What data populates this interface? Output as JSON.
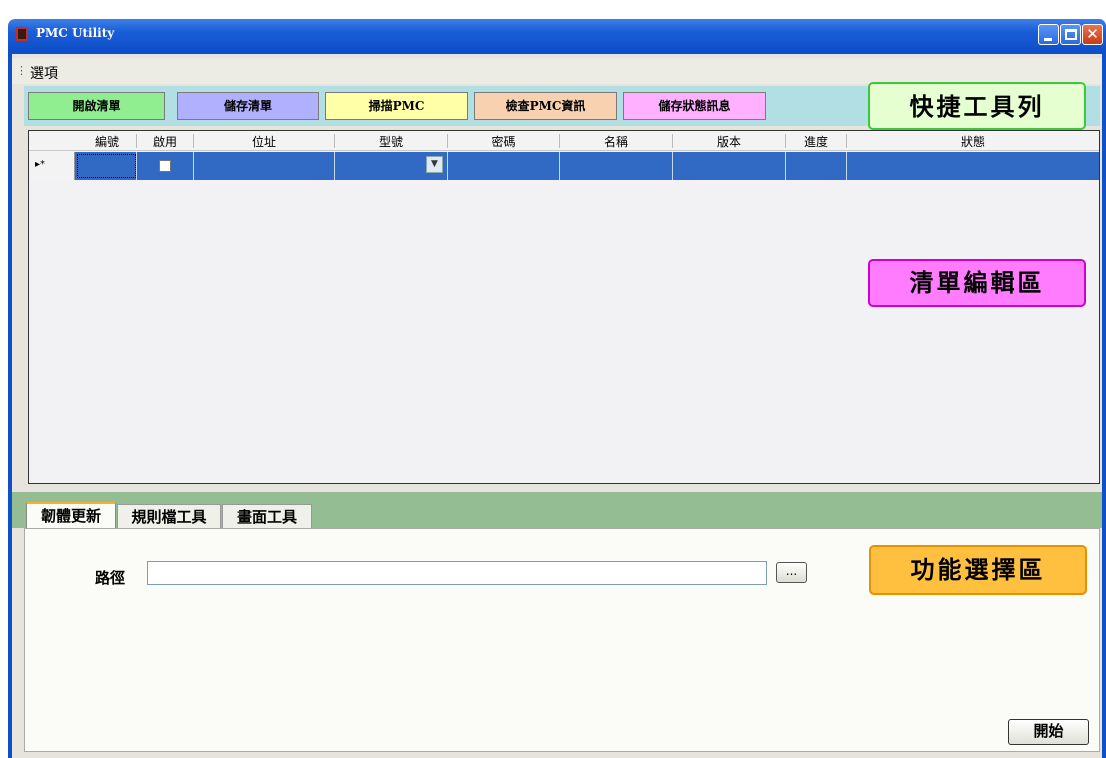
{
  "window": {
    "title": "PMC Utility",
    "icon": "app-icon"
  },
  "menu": {
    "items": [
      {
        "label": "選項"
      }
    ]
  },
  "toolbar": {
    "buttons": [
      {
        "label": "開啟清單",
        "color": "#90ee90"
      },
      {
        "label": "儲存清單",
        "color": "#b0b0ff"
      },
      {
        "label": "掃描PMC",
        "color": "#ffffa8"
      },
      {
        "label": "檢查PMC資訊",
        "color": "#f8d2b0"
      },
      {
        "label": "儲存狀態訊息",
        "color": "#ffb0ff"
      }
    ]
  },
  "callouts": {
    "toolbar": {
      "label": "快捷工具列",
      "color": "#e6ffd0",
      "border": "#3cc83c"
    },
    "list": {
      "label": "清單編輯區",
      "color": "#ff7cff",
      "border": "#d000d0"
    },
    "function": {
      "label": "功能選擇區",
      "color": "#ffc040",
      "border": "#e89000"
    }
  },
  "grid": {
    "columns": [
      "編號",
      "啟用",
      "位址",
      "型號",
      "密碼",
      "名稱",
      "版本",
      "進度",
      "狀態"
    ],
    "new_row_marker": "▸*",
    "row_color": "#316ac5"
  },
  "tabs": [
    {
      "label": "韌體更新",
      "active": true
    },
    {
      "label": "規則檔工具",
      "active": false
    },
    {
      "label": "畫面工具",
      "active": false
    }
  ],
  "firmware": {
    "path_label": "路徑",
    "path_value": "",
    "browse_label": "...",
    "start_label": "開始"
  }
}
